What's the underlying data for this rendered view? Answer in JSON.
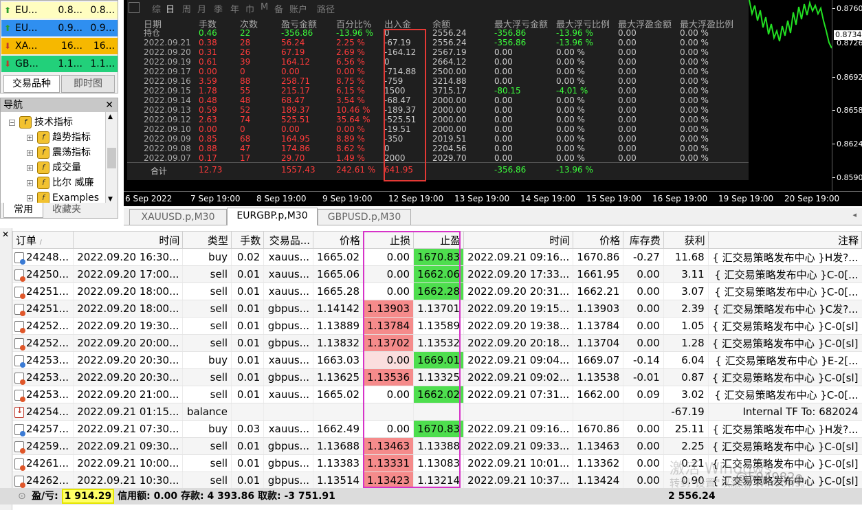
{
  "market_watch": {
    "rows": [
      {
        "symbol": "EU...",
        "bid": "0.8...",
        "ask": "0.8...",
        "bg": "#fffdc0",
        "dir": "up",
        "dir_color": "#2a9d2a"
      },
      {
        "symbol": "EU...",
        "bid": "0.9...",
        "ask": "0.9...",
        "bg": "#2f8ff0",
        "dir": "up",
        "dir_color": "#2a9d2a"
      },
      {
        "symbol": "XA...",
        "bid": "16...",
        "ask": "16...",
        "bg": "#f6b800",
        "dir": "down",
        "dir_color": "#c0392b"
      },
      {
        "symbol": "GB...",
        "bid": "1.1...",
        "ask": "1.1...",
        "bg": "#22d07a",
        "dir": "down",
        "dir_color": "#c0392b"
      }
    ],
    "tabs": [
      "交易品种",
      "即时图"
    ],
    "active_tab": 0
  },
  "navigator": {
    "title": "导航",
    "root": "技术指标",
    "items": [
      "趋势指标",
      "震荡指标",
      "成交量",
      "比尔 威廉",
      "Examples"
    ],
    "tabs": [
      "常用",
      "收藏夹"
    ]
  },
  "chart": {
    "price_labels": [
      "0.8760",
      "0.8734",
      "0.8726",
      "0.8692",
      "0.8658",
      "0.8624",
      "0.8590"
    ],
    "current_price": "0.8734",
    "time_labels": [
      "6 Sep 2022",
      "7 Sep 19:00",
      "8 Sep 19:00",
      "9 Sep 19:00",
      "12 Sep 19:00",
      "13 Sep 19:00",
      "14 Sep 19:00",
      "15 Sep 19:00",
      "16 Sep 19:00",
      "19 Sep 19:00",
      "20 Sep 19:00"
    ],
    "tabs": [
      "XAUUSD.p,M30",
      "EURGBP.p,M30",
      "GBPUSD.p,M30"
    ],
    "active_tab": 1
  },
  "stats": {
    "menu": [
      "综",
      "日",
      "周",
      "月",
      "季",
      "年",
      "巾",
      "M",
      "备",
      "账户",
      "路径"
    ],
    "headers": [
      "日期",
      "手数",
      "次数",
      "盈亏金额",
      "百分比%",
      "出入金",
      "余额",
      "最大浮亏金额",
      "最大浮亏比例",
      "最大浮盈金额",
      "最大浮盈比例"
    ],
    "hold_row": {
      "label": "持仓",
      "lots": "0.46",
      "count": "22",
      "pl": "-356.86",
      "pct": "-13.96 %",
      "cash": "0",
      "balance": "2556.24",
      "maxfl": "-356.86",
      "maxflp": "-13.96 %",
      "maxfp": "0.00",
      "maxfpp": "0.00 %"
    },
    "rows": [
      {
        "date": "2022.09.21",
        "lots": "0.38",
        "count": "28",
        "pl": "56.24",
        "pct": "2.25 %",
        "cash": "-67.19",
        "balance": "2556.24",
        "maxfl": "-356.86",
        "maxflp": "-13.96 %",
        "maxfp": "0.00",
        "maxfpp": "0.00 %"
      },
      {
        "date": "2022.09.20",
        "lots": "0.31",
        "count": "26",
        "pl": "67.19",
        "pct": "2.69 %",
        "cash": "-164.12",
        "balance": "2567.19",
        "maxfl": "0.00",
        "maxflp": "0.00 %",
        "maxfp": "0.00",
        "maxfpp": "0.00 %"
      },
      {
        "date": "2022.09.19",
        "lots": "0.61",
        "count": "39",
        "pl": "164.12",
        "pct": "6.56 %",
        "cash": "0",
        "balance": "2664.12",
        "maxfl": "0.00",
        "maxflp": "0.00 %",
        "maxfp": "0.00",
        "maxfpp": "0.00 %"
      },
      {
        "date": "2022.09.17",
        "lots": "0.00",
        "count": "0",
        "pl": "0.00",
        "pct": "0.00 %",
        "cash": "-714.88",
        "balance": "2500.00",
        "maxfl": "0.00",
        "maxflp": "0.00 %",
        "maxfp": "0.00",
        "maxfpp": "0.00 %"
      },
      {
        "date": "2022.09.16",
        "lots": "3.59",
        "count": "88",
        "pl": "258.71",
        "pct": "8.75 %",
        "cash": "-759",
        "balance": "3214.88",
        "maxfl": "0.00",
        "maxflp": "0.00 %",
        "maxfp": "0.00",
        "maxfpp": "0.00 %"
      },
      {
        "date": "2022.09.15",
        "lots": "1.78",
        "count": "55",
        "pl": "215.17",
        "pct": "6.15 %",
        "cash": "1500",
        "balance": "3715.17",
        "maxfl": "-80.15",
        "maxflp": "-4.01 %",
        "maxfp": "0.00",
        "maxfpp": "0.00 %"
      },
      {
        "date": "2022.09.14",
        "lots": "0.48",
        "count": "48",
        "pl": "68.47",
        "pct": "3.54 %",
        "cash": "-68.47",
        "balance": "2000.00",
        "maxfl": "0.00",
        "maxflp": "0.00 %",
        "maxfp": "0.00",
        "maxfpp": "0.00 %"
      },
      {
        "date": "2022.09.13",
        "lots": "0.59",
        "count": "52",
        "pl": "189.37",
        "pct": "10.46 %",
        "cash": "-189.37",
        "balance": "2000.00",
        "maxfl": "0.00",
        "maxflp": "0.00 %",
        "maxfp": "0.00",
        "maxfpp": "0.00 %"
      },
      {
        "date": "2022.09.12",
        "lots": "2.63",
        "count": "74",
        "pl": "525.51",
        "pct": "35.64 %",
        "cash": "-525.51",
        "balance": "2000.00",
        "maxfl": "0.00",
        "maxflp": "0.00 %",
        "maxfp": "0.00",
        "maxfpp": "0.00 %"
      },
      {
        "date": "2022.09.10",
        "lots": "0.00",
        "count": "0",
        "pl": "0.00",
        "pct": "0.00 %",
        "cash": "-19.51",
        "balance": "2000.00",
        "maxfl": "0.00",
        "maxflp": "0.00 %",
        "maxfp": "0.00",
        "maxfpp": "0.00 %"
      },
      {
        "date": "2022.09.09",
        "lots": "0.85",
        "count": "68",
        "pl": "164.95",
        "pct": "8.89 %",
        "cash": "-350",
        "balance": "2019.51",
        "maxfl": "0.00",
        "maxflp": "0.00 %",
        "maxfp": "0.00",
        "maxfpp": "0.00 %"
      },
      {
        "date": "2022.09.08",
        "lots": "0.88",
        "count": "47",
        "pl": "174.86",
        "pct": "8.62 %",
        "cash": "0",
        "balance": "2204.56",
        "maxfl": "0.00",
        "maxflp": "0.00 %",
        "maxfp": "0.00",
        "maxfpp": "0.00 %"
      },
      {
        "date": "2022.09.07",
        "lots": "0.17",
        "count": "17",
        "pl": "29.70",
        "pct": "1.49 %",
        "cash": "2000",
        "balance": "2029.70",
        "maxfl": "0.00",
        "maxflp": "0.00 %",
        "maxfp": "0.00",
        "maxfpp": "0.00 %"
      }
    ],
    "total": {
      "label": "合计",
      "lots": "12.73",
      "pl": "1557.43",
      "pct": "242.61 %",
      "cash": "641.95",
      "maxfl": "-356.86",
      "maxflp": "-13.96 %"
    }
  },
  "history": {
    "columns": [
      "订单",
      "时间",
      "类型",
      "手数",
      "交易品...",
      "价格",
      "止损",
      "止盈",
      "时间",
      "价格",
      "库存费",
      "获利",
      "注释"
    ],
    "rows": [
      {
        "ticket": "24248...",
        "open_time": "2022.09.20 16:30...",
        "type": "buy",
        "lots": "0.02",
        "symbol": "xauus...",
        "price": "1665.02",
        "sl": "0.00",
        "tp": "1670.83",
        "close_time": "2022.09.21 09:16...",
        "close_price": "1670.86",
        "swap": "-0.27",
        "profit": "11.68",
        "comment": "{ 汇交易策略发布中心 }H发?...",
        "sl_hl": "",
        "tp_hl": "hit",
        "icon": "buy"
      },
      {
        "ticket": "24250...",
        "open_time": "2022.09.20 17:00...",
        "type": "sell",
        "lots": "0.01",
        "symbol": "xauus...",
        "price": "1665.06",
        "sl": "0.00",
        "tp": "1662.06",
        "close_time": "2022.09.20 17:33...",
        "close_price": "1661.95",
        "swap": "0.00",
        "profit": "3.11",
        "comment": "{ 汇交易策略发布中心 }C-0[...",
        "sl_hl": "",
        "tp_hl": "hit",
        "icon": "sell"
      },
      {
        "ticket": "24251...",
        "open_time": "2022.09.20 18:00...",
        "type": "sell",
        "lots": "0.01",
        "symbol": "xauus...",
        "price": "1665.28",
        "sl": "0.00",
        "tp": "1662.28",
        "close_time": "2022.09.20 20:31...",
        "close_price": "1662.21",
        "swap": "0.00",
        "profit": "3.07",
        "comment": "{ 汇交易策略发布中心 }C-0[...",
        "sl_hl": "",
        "tp_hl": "hit",
        "icon": "sell"
      },
      {
        "ticket": "24251...",
        "open_time": "2022.09.20 18:00...",
        "type": "sell",
        "lots": "0.01",
        "symbol": "gbpus...",
        "price": "1.14142",
        "sl": "1.13903",
        "tp": "1.13701",
        "close_time": "2022.09.20 19:15...",
        "close_price": "1.13903",
        "swap": "0.00",
        "profit": "2.39",
        "comment": "{ 汇交易策略发布中心 }C发?...",
        "sl_hl": "hit",
        "tp_hl": "",
        "icon": "sell"
      },
      {
        "ticket": "24252...",
        "open_time": "2022.09.20 19:30...",
        "type": "sell",
        "lots": "0.01",
        "symbol": "gbpus...",
        "price": "1.13889",
        "sl": "1.13784",
        "tp": "1.13589",
        "close_time": "2022.09.20 19:38...",
        "close_price": "1.13784",
        "swap": "0.00",
        "profit": "1.05",
        "comment": "{ 汇交易策略发布中心 }C-0[sl]",
        "sl_hl": "hit",
        "tp_hl": "",
        "icon": "sell"
      },
      {
        "ticket": "24252...",
        "open_time": "2022.09.20 20:00...",
        "type": "sell",
        "lots": "0.01",
        "symbol": "gbpus...",
        "price": "1.13832",
        "sl": "1.13702",
        "tp": "1.13532",
        "close_time": "2022.09.20 20:18...",
        "close_price": "1.13704",
        "swap": "0.00",
        "profit": "1.28",
        "comment": "{ 汇交易策略发布中心 }C-0[sl]",
        "sl_hl": "hit",
        "tp_hl": "",
        "icon": "sell"
      },
      {
        "ticket": "24253...",
        "open_time": "2022.09.20 20:30...",
        "type": "buy",
        "lots": "0.01",
        "symbol": "xauus...",
        "price": "1663.03",
        "sl": "0.00",
        "tp": "1669.01",
        "close_time": "2022.09.21 09:04...",
        "close_price": "1669.07",
        "swap": "-0.14",
        "profit": "6.04",
        "comment": "{ 汇交易策略发布中心 }E-2[...",
        "sl_hl": "soft",
        "tp_hl": "hit",
        "icon": "buy"
      },
      {
        "ticket": "24253...",
        "open_time": "2022.09.20 20:30...",
        "type": "sell",
        "lots": "0.01",
        "symbol": "gbpus...",
        "price": "1.13625",
        "sl": "1.13536",
        "tp": "1.13325",
        "close_time": "2022.09.21 09:02...",
        "close_price": "1.13538",
        "swap": "-0.01",
        "profit": "0.87",
        "comment": "{ 汇交易策略发布中心 }C-0[sl]",
        "sl_hl": "hit",
        "tp_hl": "",
        "icon": "sell"
      },
      {
        "ticket": "24253...",
        "open_time": "2022.09.20 21:00...",
        "type": "sell",
        "lots": "0.01",
        "symbol": "xauus...",
        "price": "1665.02",
        "sl": "0.00",
        "tp": "1662.02",
        "close_time": "2022.09.21 07:31...",
        "close_price": "1662.00",
        "swap": "0.09",
        "profit": "3.02",
        "comment": "{ 汇交易策略发布中心 }C-0[...",
        "sl_hl": "",
        "tp_hl": "hit",
        "icon": "sell"
      },
      {
        "ticket": "24254...",
        "open_time": "2022.09.21 01:15...",
        "type": "balance",
        "lots": "",
        "symbol": "",
        "price": "",
        "sl": "",
        "tp": "",
        "close_time": "",
        "close_price": "",
        "swap": "",
        "profit": "-67.19",
        "comment": "Internal TF To: 682024",
        "sl_hl": "",
        "tp_hl": "",
        "icon": "balance"
      },
      {
        "ticket": "24257...",
        "open_time": "2022.09.21 07:30...",
        "type": "buy",
        "lots": "0.03",
        "symbol": "xauus...",
        "price": "1662.49",
        "sl": "0.00",
        "tp": "1670.83",
        "close_time": "2022.09.21 09:16...",
        "close_price": "1670.86",
        "swap": "0.00",
        "profit": "25.11",
        "comment": "{ 汇交易策略发布中心 }H发?...",
        "sl_hl": "",
        "tp_hl": "hit",
        "icon": "buy"
      },
      {
        "ticket": "24259...",
        "open_time": "2022.09.21 09:30...",
        "type": "sell",
        "lots": "0.01",
        "symbol": "gbpus...",
        "price": "1.13688",
        "sl": "1.13463",
        "tp": "1.13388",
        "close_time": "2022.09.21 09:33...",
        "close_price": "1.13463",
        "swap": "0.00",
        "profit": "2.25",
        "comment": "{ 汇交易策略发布中心 }C-0[sl]",
        "sl_hl": "hit",
        "tp_hl": "",
        "icon": "sell"
      },
      {
        "ticket": "24261...",
        "open_time": "2022.09.21 10:00...",
        "type": "sell",
        "lots": "0.01",
        "symbol": "gbpus...",
        "price": "1.13383",
        "sl": "1.13331",
        "tp": "1.13083",
        "close_time": "2022.09.21 10:01...",
        "close_price": "1.13362",
        "swap": "0.00",
        "profit": "0.21",
        "comment": "{ 汇交易策略发布中心 }C-0[sl]",
        "sl_hl": "hit",
        "tp_hl": "",
        "icon": "sell"
      },
      {
        "ticket": "24262...",
        "open_time": "2022.09.21 10:30...",
        "type": "sell",
        "lots": "0.01",
        "symbol": "gbpus...",
        "price": "1.13514",
        "sl": "1.13423",
        "tp": "1.13214",
        "close_time": "2022.09.21 10:37...",
        "close_price": "1.13424",
        "swap": "0.00",
        "profit": "0.90",
        "comment": "{ 汇交易策略发布中心 }C-0[sl]",
        "sl_hl": "hit",
        "tp_hl": "",
        "icon": "sell"
      }
    ]
  },
  "status": {
    "pl_label": "盈/亏:",
    "pl_value": "1 914.29",
    "rest": "信用额: 0.00  存款: 4 393.86  取款: -3 751.91",
    "balance": "2 556.24"
  },
  "watermark": {
    "line1": "激活 Windows",
    "line2": "转到\"设置\"以激活 Windows。",
    "handle": "@594982o"
  },
  "colors": {
    "sl_hit": "#f58b8b",
    "tp_hit": "#4ede4e",
    "stats_negative": "#ff3b3b",
    "stats_positive": "#3cff3c",
    "red_outline": "#e53935",
    "magenta_outline": "#d633c8"
  }
}
